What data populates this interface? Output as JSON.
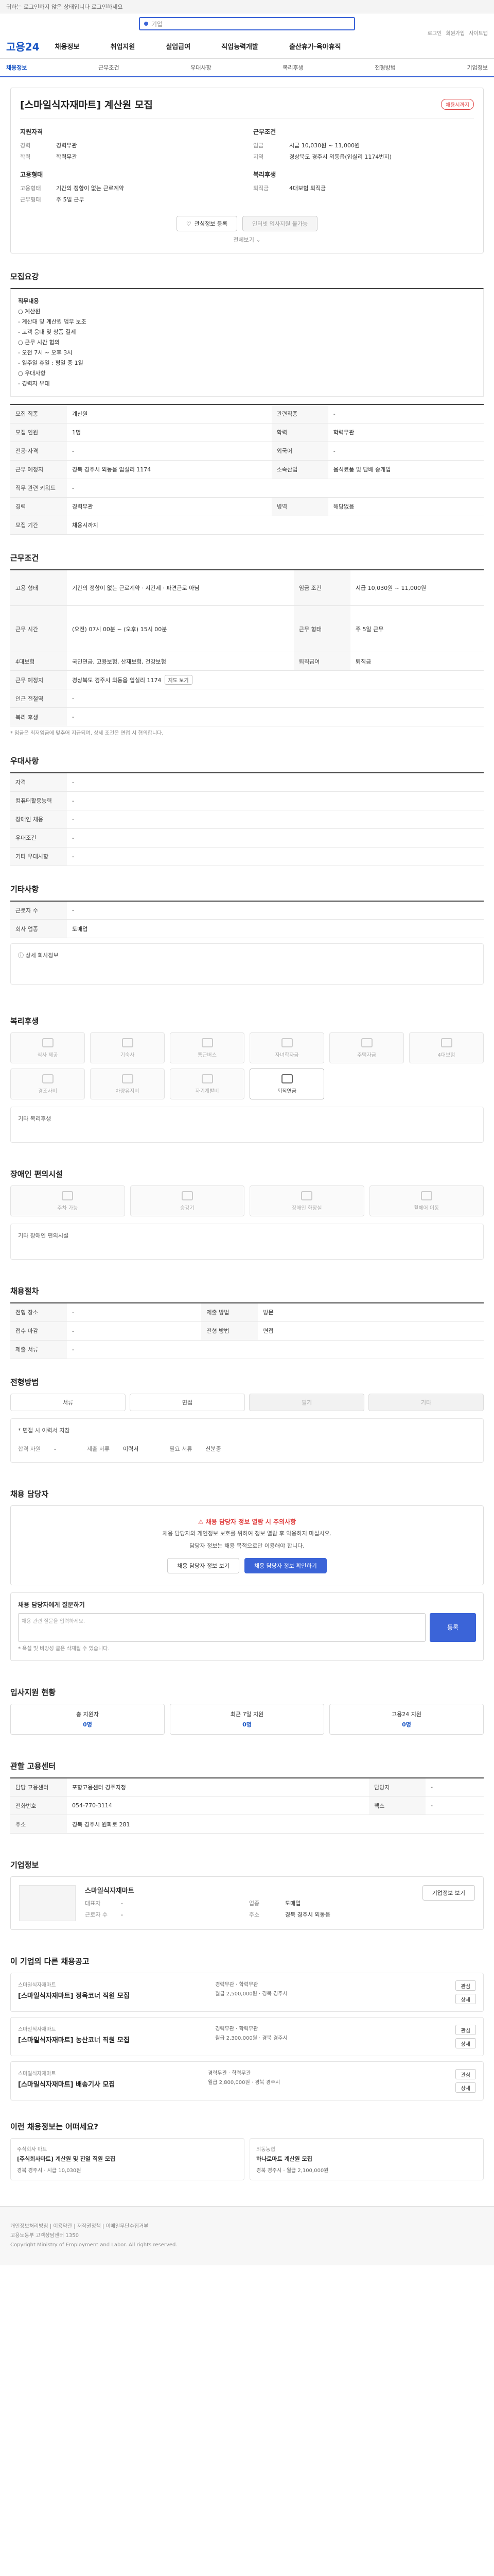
{
  "topbar": {
    "text": "귀하는 로그인하지 않은 상태입니다 로그인하세요"
  },
  "search": {
    "placeholder": "기업"
  },
  "util": [
    "로그인",
    "회원가입",
    "사이트맵"
  ],
  "header": {
    "logo": "고용24",
    "menu": [
      "채용정보",
      "취업지원",
      "실업급여",
      "직업능력개발",
      "출산휴가·육아휴직"
    ]
  },
  "subnav": {
    "items": [
      "채용정보",
      "근무조건",
      "우대사항",
      "복리후생",
      "전형방법",
      "기업정보"
    ]
  },
  "job": {
    "title": "[스마일식자재마트] 계산원 모집",
    "badge": "채용시까지",
    "left_cap": "지원자격",
    "left": [
      {
        "k": "경력",
        "v": "경력무관"
      },
      {
        "k": "학력",
        "v": "학력무관"
      }
    ],
    "left_cap2": "고용형태",
    "left2": [
      {
        "k": "고용형태",
        "v": "기간의 정함이 없는 근로계약"
      },
      {
        "k": "근무형태",
        "v": "주 5일 근무"
      }
    ],
    "right_cap": "근무조건",
    "right": [
      {
        "k": "임금",
        "v": "시급 10,030원 ~ 11,000원"
      },
      {
        "k": "지역",
        "v": "경상북도 경주시 외동읍(입실리 1174번지)"
      }
    ],
    "right_cap2": "복리후생",
    "right2": [
      {
        "k": "퇴직금",
        "v": "4대보험 퇴직금"
      }
    ],
    "btn_save": "관심정보 등록",
    "btn_apply": "인터넷 입사지원 불가능",
    "more": "전체보기"
  },
  "detail": {
    "title": "모집요강",
    "desc_lines": [
      "직무내용",
      "○ 계산원",
      " - 계산대 및 계산원 업무 보조",
      " - 고객 응대 및 상품 결제",
      "○ 근무 시간 협의",
      " - 오전 7시 ~ 오후 3시",
      " - 일주일 휴일 : 평일 중 1일",
      "○ 우대사항",
      " - 경력자 우대"
    ],
    "rows": [
      {
        "k1": "모집 직종",
        "v1": "계산원",
        "k2": "관련직종",
        "v2": "-"
      },
      {
        "k1": "모집 인원",
        "v1": "1명",
        "k2": "학력",
        "v2": "학력무관"
      },
      {
        "k1": "전공·자격",
        "v1": "-",
        "k2": "외국어",
        "v2": "-"
      },
      {
        "k1": "근무 예정지",
        "v1": "경북 경주시 외동읍 입실리 1174",
        "k2": "소속산업",
        "v2": "음식료품 및 담배 중개업"
      },
      {
        "k1": "직무 관련 키워드",
        "v1": "-",
        "k2": "",
        "v2": ""
      },
      {
        "k1": "경력",
        "v1": "경력무관",
        "k2": "병역",
        "v2": "해당없음"
      },
      {
        "k1": "모집 기간",
        "v1": "채용시까지",
        "k2": "",
        "v2": ""
      }
    ]
  },
  "cond": {
    "title": "근무조건",
    "rows": [
      {
        "k1": "고용 형태",
        "v1": "기간의 정함이 없는 근로계약 · 시간제 · 파견근로 아님",
        "k2": "임금 조건",
        "v2": "시급 10,030원 ~ 11,000원"
      },
      {
        "k1": "근무 시간",
        "v1": "(오전) 07시 00분 ~ (오후) 15시 00분",
        "k2": "근무 형태",
        "v2": "주 5일 근무"
      },
      {
        "k1": "4대보험",
        "v1": "국민연금, 고용보험, 산재보험, 건강보험",
        "k2": "퇴직급여",
        "v2": "퇴직금"
      },
      {
        "k1": "근무 예정지",
        "v1": "경상북도 경주시 외동읍 입실리 1174",
        "k2": "",
        "v2": ""
      },
      {
        "k1": "인근 전철역",
        "v1": "-",
        "k2": "",
        "v2": ""
      },
      {
        "k1": "복리 후생",
        "v1": "-",
        "k2": "",
        "v2": ""
      }
    ],
    "tag": "지도 보기",
    "note": "* 임금은 최저임금에 맞추어 지급되며, 상세 조건은 면접 시 협의합니다."
  },
  "pref": {
    "title": "우대사항",
    "rows": [
      {
        "k": "자격",
        "v": "-"
      },
      {
        "k": "컴퓨터활용능력",
        "v": "-"
      },
      {
        "k": "장애인 채용",
        "v": "-"
      },
      {
        "k": "우대조건",
        "v": "-"
      },
      {
        "k": "기타 우대사항",
        "v": "-"
      }
    ]
  },
  "etc": {
    "title": "기타사항",
    "rows": [
      {
        "k": "근로자 수",
        "v": "-"
      },
      {
        "k": "회사 업종",
        "v": "도매업"
      }
    ],
    "more": "상세 회사정보"
  },
  "welfare": {
    "title": "복리후생",
    "items": [
      "식사 제공",
      "기숙사",
      "통근버스",
      "자녀학자금",
      "주택자금",
      "4대보험",
      "경조사비",
      "차량유지비",
      "자기계발비",
      "퇴직연금"
    ],
    "extra": "기타 복리후생"
  },
  "disabled": {
    "title": "장애인 편의시설",
    "items": [
      "주차 가능",
      "승강기",
      "장애인 화장실",
      "휠체어 이동"
    ],
    "note": "기타 장애인 편의시설"
  },
  "screening": {
    "title": "채용절차",
    "rows": [
      {
        "k": "전형 장소",
        "v": "-"
      },
      {
        "k": "접수 마감",
        "v": "-"
      },
      {
        "k": "제출 서류",
        "v": "-"
      }
    ],
    "rows2": [
      {
        "k": "제출 방법",
        "v": "방문"
      },
      {
        "k": "전형 방법",
        "v": "면접"
      }
    ]
  },
  "method": {
    "title": "전형방법",
    "steps": [
      "서류",
      "면접",
      "필기",
      "기타"
    ],
    "note": "* 면접 시 이력서 지참",
    "sub": [
      {
        "k": "합격 자원",
        "v": "-"
      },
      {
        "k": "제출 서류",
        "v": "이력서"
      },
      {
        "k": "필요 서류",
        "v": "신분증"
      }
    ]
  },
  "contact": {
    "title": "채용 담당자",
    "red": "채용 담당자 정보 열람 시 주의사항",
    "line1": "채용 담당자와 개인정보 보호를 위하여 정보 열람 후 악용하지 마십시오.",
    "line2": "담당자 정보는 채용 목적으로만 이용해야 합니다.",
    "btn1": "채용 담당자 정보 보기",
    "btn2": "채용 담당자 정보 확인하기"
  },
  "inquiry": {
    "title": "채용 담당자에게 질문하기",
    "placeholder": "채용 관련 질문을 입력하세요.",
    "send": "등록",
    "note": "* 욕설 및 비방성 글은 삭제될 수 있습니다."
  },
  "status": {
    "title": "입사지원 현황",
    "cards": [
      {
        "label": "총 지원자",
        "value": "0명"
      },
      {
        "label": "최근 7일 지원",
        "value": "0명"
      },
      {
        "label": "고용24 지원",
        "value": "0명"
      }
    ]
  },
  "agency": {
    "title": "관할 고용센터",
    "rows": [
      {
        "k1": "담당 고용센터",
        "v1": "포항고용센터 경주지청",
        "k2": "담당자",
        "v2": "-"
      },
      {
        "k1": "전화번호",
        "v1": "054-770-3114",
        "k2": "팩스",
        "v2": "-"
      },
      {
        "k1": "주소",
        "v1": "경북 경주시 원화로 281",
        "k2": "",
        "v2": ""
      }
    ]
  },
  "company": {
    "title": "기업정보",
    "name": "스마일식자재마트",
    "rows": [
      {
        "k": "대표자",
        "v": "-"
      },
      {
        "k": "업종",
        "v": "도매업"
      },
      {
        "k": "근로자 수",
        "v": "-"
      },
      {
        "k": "주소",
        "v": "경북 경주시 외동읍"
      }
    ],
    "btn": "기업정보 보기"
  },
  "related": {
    "title": "이 기업의 다른 채용공고",
    "jobs": [
      {
        "co": "스마일식자재마트",
        "ti": "[스마일식자재마트] 정육코너 직원 모집",
        "m1": "경력무관 · 학력무관",
        "m2": "월급 2,500,000원 · 경북 경주시",
        "b1": "관심",
        "b2": "상세"
      },
      {
        "co": "스마일식자재마트",
        "ti": "[스마일식자재마트] 농산코너 직원 모집",
        "m1": "경력무관 · 학력무관",
        "m2": "월급 2,300,000원 · 경북 경주시",
        "b1": "관심",
        "b2": "상세"
      },
      {
        "co": "스마일식자재마트",
        "ti": "[스마일식자재마트] 배송기사 모집",
        "m1": "경력무관 · 학력무관",
        "m2": "월급 2,800,000원 · 경북 경주시",
        "b1": "관심",
        "b2": "상세"
      }
    ]
  },
  "recommend": {
    "title": "이런 채용정보는 어떠세요?",
    "items": [
      {
        "nm": "주식회사 마트",
        "tt": "[주식회사마트] 계산원 및 진열 직원 모집",
        "meta": "경북 경주시 · 시급 10,030원"
      },
      {
        "nm": "외동농협",
        "tt": "하나로마트 계산원 모집",
        "meta": "경북 경주시 · 월급 2,100,000원"
      }
    ]
  },
  "footer": {
    "line1": "개인정보처리방침 | 이용약관 | 저작권정책 | 이메일무단수집거부",
    "line2": "고용노동부 고객상담센터 1350",
    "line3": "Copyright Ministry of Employment and Labor. All rights reserved."
  }
}
